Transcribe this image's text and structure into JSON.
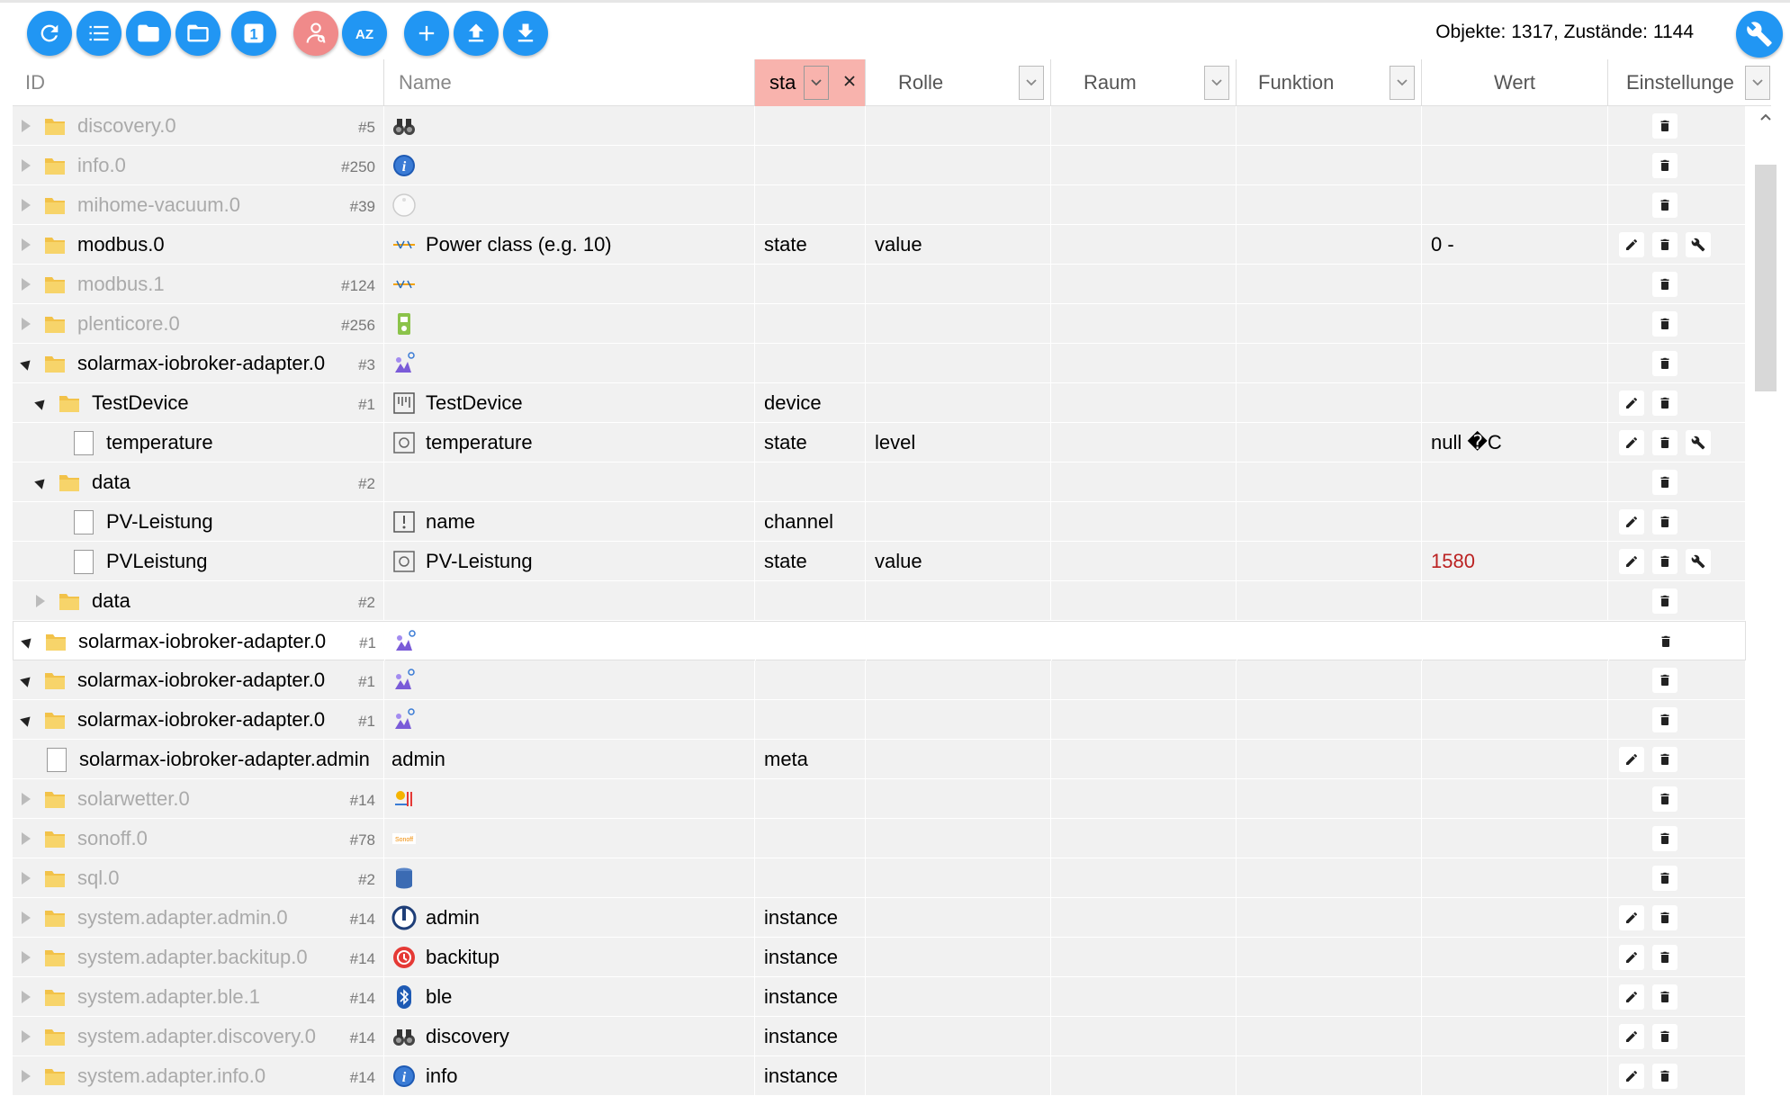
{
  "toolbar": {
    "buttons": [
      {
        "name": "refresh-button",
        "icon": "refresh-icon"
      },
      {
        "name": "list-view-button",
        "icon": "list-icon"
      },
      {
        "name": "folder-collapse-button",
        "icon": "folder-icon"
      },
      {
        "name": "folder-expand-button",
        "icon": "folder-open-icon"
      },
      {
        "name": "expand-level-button",
        "icon": "number-one-icon"
      },
      {
        "name": "expert-mode-button",
        "icon": "expert-icon"
      },
      {
        "name": "sort-button",
        "icon": "az-sort-icon"
      },
      {
        "name": "add-object-button",
        "icon": "plus-icon"
      },
      {
        "name": "upload-button",
        "icon": "upload-icon"
      },
      {
        "name": "download-button",
        "icon": "download-icon"
      }
    ],
    "level_label": "1",
    "sort_label": "AZ",
    "counts": "Objekte: 1317, Zustände: 1144",
    "accent_color": "#2196f3",
    "expert_color": "#f08a8a"
  },
  "header": {
    "id_placeholder": "ID",
    "name_placeholder": "Name",
    "type_filter": "sta",
    "role": "Rolle",
    "room": "Raum",
    "function": "Funktion",
    "value": "Wert",
    "settings": "Einstellunge",
    "type_filter_color": "#f8b3ad"
  },
  "rows": [
    {
      "id": "discovery.0",
      "count": "#5",
      "level": 0,
      "kind": "folder",
      "arrow": "closed",
      "dim": true,
      "icon": "binoculars-icon",
      "name": "",
      "type": "",
      "role": "",
      "value": "",
      "actions": [
        "delete"
      ]
    },
    {
      "id": "info.0",
      "count": "#250",
      "level": 0,
      "kind": "folder",
      "arrow": "closed",
      "dim": true,
      "icon": "info-icon",
      "name": "",
      "type": "",
      "role": "",
      "value": "",
      "actions": [
        "delete"
      ]
    },
    {
      "id": "mihome-vacuum.0",
      "count": "#39",
      "level": 0,
      "kind": "folder",
      "arrow": "closed",
      "dim": true,
      "icon": "vacuum-icon",
      "name": "",
      "type": "",
      "role": "",
      "value": "",
      "actions": [
        "delete"
      ]
    },
    {
      "id": "modbus.0",
      "count": "",
      "level": 0,
      "kind": "folder",
      "arrow": "closed",
      "dim": false,
      "icon": "modbus-icon",
      "name": "Power class (e.g. 10)",
      "type": "state",
      "role": "value",
      "value": "0 -",
      "actions": [
        "edit",
        "delete",
        "settings"
      ]
    },
    {
      "id": "modbus.1",
      "count": "#124",
      "level": 0,
      "kind": "folder",
      "arrow": "closed",
      "dim": true,
      "icon": "modbus-icon",
      "name": "",
      "type": "",
      "role": "",
      "value": "",
      "actions": [
        "delete"
      ]
    },
    {
      "id": "plenticore.0",
      "count": "#256",
      "level": 0,
      "kind": "folder",
      "arrow": "closed",
      "dim": true,
      "icon": "inverter-icon",
      "name": "",
      "type": "",
      "role": "",
      "value": "",
      "actions": [
        "delete"
      ]
    },
    {
      "id": "solarmax-iobroker-adapter.0",
      "count": "#3",
      "level": 0,
      "kind": "folder",
      "arrow": "open",
      "dim": false,
      "icon": "solarmax-icon",
      "name": "",
      "type": "",
      "role": "",
      "value": "",
      "actions": [
        "delete"
      ]
    },
    {
      "id": "TestDevice",
      "count": "#1",
      "level": 1,
      "kind": "folder",
      "arrow": "open",
      "dim": false,
      "icon": "device-icon",
      "name": "TestDevice",
      "type": "device",
      "role": "",
      "value": "",
      "actions": [
        "edit",
        "delete"
      ]
    },
    {
      "id": "temperature",
      "count": "",
      "level": 2,
      "kind": "file",
      "arrow": "",
      "dim": false,
      "icon": "state-icon",
      "name": "temperature",
      "type": "state",
      "role": "level",
      "value": "null �C",
      "actions": [
        "edit",
        "delete",
        "settings"
      ]
    },
    {
      "id": "data",
      "count": "#2",
      "level": 1,
      "kind": "folder",
      "arrow": "open",
      "dim": false,
      "icon": "",
      "name": "",
      "type": "",
      "role": "",
      "value": "",
      "actions": [
        "delete"
      ]
    },
    {
      "id": "PV-Leistung",
      "count": "",
      "level": 2,
      "kind": "file",
      "arrow": "",
      "dim": false,
      "icon": "channel-icon",
      "name": "name",
      "type": "channel",
      "role": "",
      "value": "",
      "actions": [
        "edit",
        "delete"
      ]
    },
    {
      "id": "PVLeistung",
      "count": "",
      "level": 2,
      "kind": "file",
      "arrow": "",
      "dim": false,
      "icon": "state-icon",
      "name": "PV-Leistung",
      "type": "state",
      "role": "value",
      "value": "1580",
      "value_red": true,
      "actions": [
        "edit",
        "delete",
        "settings"
      ]
    },
    {
      "id": "data",
      "count": "#2",
      "level": 1,
      "kind": "folder",
      "arrow": "closed",
      "dim": false,
      "icon": "",
      "name": "",
      "type": "",
      "role": "",
      "value": "",
      "actions": [
        "delete"
      ]
    },
    {
      "id": "solarmax-iobroker-adapter.0",
      "count": "#1",
      "level": 0,
      "kind": "folder",
      "arrow": "open",
      "dim": false,
      "icon": "solarmax-icon",
      "name": "",
      "type": "",
      "role": "",
      "value": "",
      "actions": [
        "delete"
      ],
      "highlight": true
    },
    {
      "id": "solarmax-iobroker-adapter.0",
      "count": "#1",
      "level": 0,
      "kind": "folder",
      "arrow": "open",
      "dim": false,
      "icon": "solarmax-icon",
      "name": "",
      "type": "",
      "role": "",
      "value": "",
      "actions": [
        "delete"
      ]
    },
    {
      "id": "solarmax-iobroker-adapter.0",
      "count": "#1",
      "level": 0,
      "kind": "folder",
      "arrow": "open",
      "dim": false,
      "icon": "solarmax-icon",
      "name": "",
      "type": "",
      "role": "",
      "value": "",
      "actions": [
        "delete"
      ]
    },
    {
      "id": "solarmax-iobroker-adapter.admin",
      "count": "",
      "level": 0,
      "kind": "file",
      "arrow": "",
      "dim": false,
      "icon": "",
      "name": "admin",
      "type": "meta",
      "role": "",
      "value": "",
      "actions": [
        "edit",
        "delete"
      ]
    },
    {
      "id": "solarwetter.0",
      "count": "#14",
      "level": 0,
      "kind": "folder",
      "arrow": "closed",
      "dim": true,
      "icon": "weather-icon",
      "name": "",
      "type": "",
      "role": "",
      "value": "",
      "actions": [
        "delete"
      ]
    },
    {
      "id": "sonoff.0",
      "count": "#78",
      "level": 0,
      "kind": "folder",
      "arrow": "closed",
      "dim": true,
      "icon": "sonoff-icon",
      "name": "",
      "type": "",
      "role": "",
      "value": "",
      "actions": [
        "delete"
      ]
    },
    {
      "id": "sql.0",
      "count": "#2",
      "level": 0,
      "kind": "folder",
      "arrow": "closed",
      "dim": true,
      "icon": "database-icon",
      "name": "",
      "type": "",
      "role": "",
      "value": "",
      "actions": [
        "delete"
      ]
    },
    {
      "id": "system.adapter.admin.0",
      "count": "#14",
      "level": 0,
      "kind": "folder",
      "arrow": "closed",
      "dim": true,
      "icon": "admin-icon",
      "name": "admin",
      "type": "instance",
      "role": "",
      "value": "",
      "actions": [
        "edit",
        "delete"
      ]
    },
    {
      "id": "system.adapter.backitup.0",
      "count": "#14",
      "level": 0,
      "kind": "folder",
      "arrow": "closed",
      "dim": true,
      "icon": "backup-icon",
      "name": "backitup",
      "type": "instance",
      "role": "",
      "value": "",
      "actions": [
        "edit",
        "delete"
      ]
    },
    {
      "id": "system.adapter.ble.1",
      "count": "#14",
      "level": 0,
      "kind": "folder",
      "arrow": "closed",
      "dim": true,
      "icon": "bluetooth-icon",
      "name": "ble",
      "type": "instance",
      "role": "",
      "value": "",
      "actions": [
        "edit",
        "delete"
      ]
    },
    {
      "id": "system.adapter.discovery.0",
      "count": "#14",
      "level": 0,
      "kind": "folder",
      "arrow": "closed",
      "dim": true,
      "icon": "binoculars-icon",
      "name": "discovery",
      "type": "instance",
      "role": "",
      "value": "",
      "actions": [
        "edit",
        "delete"
      ]
    },
    {
      "id": "system.adapter.info.0",
      "count": "#14",
      "level": 0,
      "kind": "folder",
      "arrow": "closed",
      "dim": true,
      "icon": "info-icon",
      "name": "info",
      "type": "instance",
      "role": "",
      "value": "",
      "actions": [
        "edit",
        "delete"
      ]
    }
  ]
}
